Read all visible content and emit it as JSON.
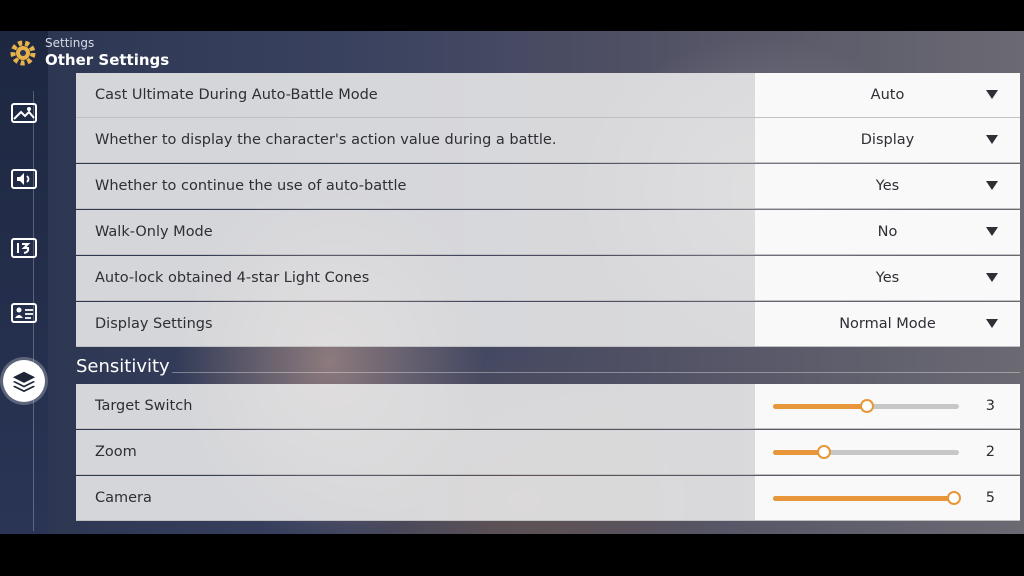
{
  "header": {
    "crumb": "Settings",
    "title": "Other Settings"
  },
  "sidebar": {
    "items": [
      {
        "name": "graphics-icon"
      },
      {
        "name": "audio-icon"
      },
      {
        "name": "language-icon"
      },
      {
        "name": "account-icon"
      },
      {
        "name": "other-settings-icon",
        "active": true
      }
    ]
  },
  "options": [
    {
      "label": "Cast Ultimate During Auto-Battle Mode",
      "value": "Auto"
    },
    {
      "label": "Whether to display the character's action value during a battle.",
      "value": "Display"
    },
    {
      "label": "Whether to continue the use of auto-battle",
      "value": "Yes"
    },
    {
      "label": "Walk-Only Mode",
      "value": "No"
    },
    {
      "label": "Auto-lock obtained 4-star Light Cones",
      "value": "Yes"
    },
    {
      "label": "Display Settings",
      "value": "Normal Mode"
    }
  ],
  "sensitivity": {
    "title": "Sensitivity",
    "items": [
      {
        "label": "Target Switch",
        "value": "3",
        "fraction": 0.5
      },
      {
        "label": "Zoom",
        "value": "2",
        "fraction": 0.27
      },
      {
        "label": "Camera",
        "value": "5",
        "fraction": 0.97
      }
    ]
  },
  "colors": {
    "accent": "#e7973a",
    "row_bg": "#ececec",
    "text": "#2e2e35"
  }
}
